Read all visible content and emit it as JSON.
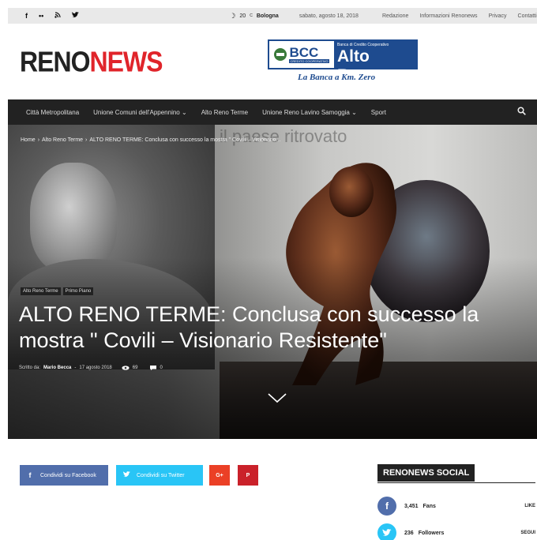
{
  "topbar": {
    "social_icons": [
      "facebook-icon",
      "flickr-icon",
      "rss-icon",
      "twitter-icon"
    ],
    "social_glyphs": [
      "f",
      "••",
      "℧",
      "ὂ6"
    ],
    "temperature": "20",
    "temp_unit": "C",
    "city": "Bologna",
    "date": "sabato, agosto 18, 2018",
    "links": [
      "Redazione",
      "Informazioni Renonews",
      "Privacy",
      "Contatti"
    ]
  },
  "header": {
    "logo_part1": "RENO",
    "logo_part2": "NEWS"
  },
  "ad": {
    "bcc": "BCC",
    "bcc_small": "CREDITO COOPERATIVO",
    "bank_line": "Banca di Credito Cooperativo",
    "bank_name": "Alto Reno",
    "slogan": "La Banca a Km. Zero"
  },
  "nav": {
    "items": [
      "Città Metropolitana",
      "Unione Comuni dell'Appennino ⌄",
      "Alto Reno Terme",
      "Unione Reno Lavino Samoggia ⌄",
      "Sport"
    ]
  },
  "article": {
    "bg_text": "il paese ritrovato",
    "breadcrumb": [
      "Home",
      "›",
      "Alto Reno Terme",
      "›",
      "ALTO RENO TERME: Conclusa con successo la mostra \" Covili – Visionario..."
    ],
    "categories": [
      "Alto Reno Terme",
      "Primo Piano"
    ],
    "title": "ALTO RENO TERME: Conclusa con successo la mostra \" Covili – Visionario Resistente\"",
    "author_prefix": "Scritto da:",
    "author": "Mario Becca",
    "sep": "-",
    "date": "17 agosto 2018",
    "views": "69",
    "comments": "0"
  },
  "share": {
    "facebook": "Condividi su Facebook",
    "twitter": "Condividi su Twitter",
    "google": "G+",
    "pinterest": "P",
    "fb_glyph": "f",
    "tw_glyph": "t"
  },
  "sidebar": {
    "heading": "RENONEWS SOCIAL",
    "counters": [
      {
        "glyph": "f",
        "count": "3,451",
        "label": "Fans",
        "action": "LIKE",
        "color": "#516eab"
      },
      {
        "glyph": "t",
        "count": "236",
        "label": "Followers",
        "action": "SEGUI",
        "color": "#29c5f6"
      }
    ]
  }
}
